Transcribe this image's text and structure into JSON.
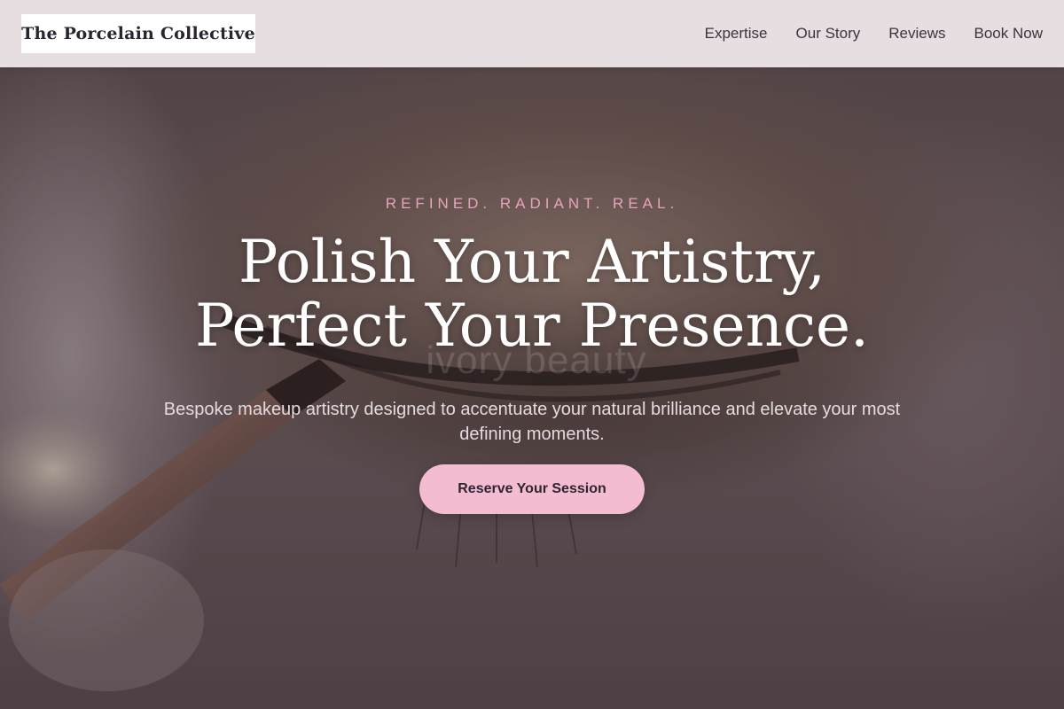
{
  "header": {
    "brand": "The Porcelain Collective",
    "nav": [
      {
        "label": "Expertise"
      },
      {
        "label": "Our Story"
      },
      {
        "label": "Reviews"
      },
      {
        "label": "Book Now"
      }
    ]
  },
  "hero": {
    "tagline": "REFINED. RADIANT. REAL.",
    "headline_line1": "Polish Your Artistry,",
    "headline_line2": "Perfect Your Presence.",
    "watermark": "ivory beauty",
    "subtext": "Bespoke makeup artistry designed to accentuate your natural brilliance and elevate your most defining moments.",
    "cta_label": "Reserve Your Session",
    "image_subject": "close-up-eye-makeup-brush"
  },
  "colors": {
    "accent_pink": "#f4bcd1",
    "tagline_pink": "#e7a4be",
    "header_bg": "#f0e8ec",
    "text_dark": "#2e2533"
  }
}
